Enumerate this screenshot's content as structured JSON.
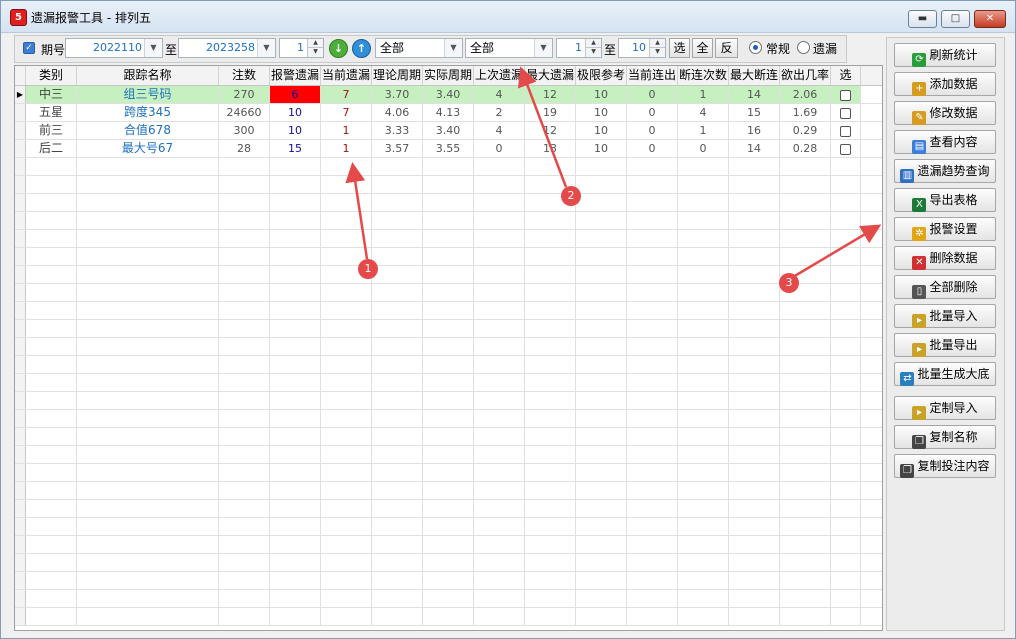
{
  "window": {
    "title": "遗漏报警工具 - 排列五",
    "app_icon": "5"
  },
  "toolbar": {
    "period_label": "期号",
    "period_from": "2022110",
    "to_label_1": "至",
    "period_to": "2023258",
    "spin_value": "1",
    "combo1": "全部",
    "combo2": "全部",
    "range_from": "1",
    "to_label_2": "至",
    "range_to": "10",
    "btn_select": "选",
    "btn_all": "全",
    "btn_invert": "反",
    "radio_normal": "常规",
    "radio_omission": "遗漏"
  },
  "table": {
    "columns": [
      "类别",
      "跟踪名称",
      "注数",
      "报警遗漏",
      "当前遗漏",
      "理论周期",
      "实际周期",
      "上次遗漏",
      "最大遗漏",
      "极限参考",
      "当前连出",
      "断连次数",
      "最大断连",
      "欲出几率",
      "选"
    ],
    "rows": [
      {
        "cat": "中三",
        "name": "组三号码",
        "count": "270",
        "alarm": "6",
        "cur": "7",
        "theory": "3.70",
        "actual": "3.40",
        "last": "4",
        "max": "12",
        "limit": "10",
        "cons": "0",
        "breaks": "1",
        "maxbreak": "14",
        "prob": "2.06"
      },
      {
        "cat": "五星",
        "name": "跨度345",
        "count": "24660",
        "alarm": "10",
        "cur": "7",
        "theory": "4.06",
        "actual": "4.13",
        "last": "2",
        "max": "19",
        "limit": "10",
        "cons": "0",
        "breaks": "4",
        "maxbreak": "15",
        "prob": "1.69"
      },
      {
        "cat": "前三",
        "name": "合值678",
        "count": "300",
        "alarm": "10",
        "cur": "1",
        "theory": "3.33",
        "actual": "3.40",
        "last": "4",
        "max": "12",
        "limit": "10",
        "cons": "0",
        "breaks": "1",
        "maxbreak": "16",
        "prob": "0.29"
      },
      {
        "cat": "后二",
        "name": "最大号67",
        "count": "28",
        "alarm": "15",
        "cur": "1",
        "theory": "3.57",
        "actual": "3.55",
        "last": "0",
        "max": "13",
        "limit": "10",
        "cons": "0",
        "breaks": "0",
        "maxbreak": "14",
        "prob": "0.28"
      }
    ]
  },
  "side_buttons": [
    {
      "label": "刷新统计",
      "icon": "refresh-icon"
    },
    {
      "label": "添加数据",
      "icon": "add-data-icon"
    },
    {
      "label": "修改数据",
      "icon": "edit-icon"
    },
    {
      "label": "查看内容",
      "icon": "view-icon"
    },
    {
      "label": "遗漏趋势查询",
      "icon": "trend-chart-icon"
    },
    {
      "label": "导出表格",
      "icon": "excel-icon"
    },
    {
      "label": "报警设置",
      "icon": "gear-icon"
    },
    {
      "label": "删除数据",
      "icon": "delete-icon"
    },
    {
      "label": "全部删除",
      "icon": "trash-icon"
    },
    {
      "label": "批量导入",
      "icon": "folder-import-icon"
    },
    {
      "label": "批量导出",
      "icon": "folder-export-icon"
    },
    {
      "label": "批量生成大底",
      "icon": "shuffle-icon"
    },
    {
      "label": "定制导入",
      "icon": "custom-import-icon"
    },
    {
      "label": "复制名称",
      "icon": "copy-icon"
    },
    {
      "label": "复制投注内容",
      "icon": "copy-icon"
    }
  ],
  "annotations": [
    "1",
    "2",
    "3"
  ],
  "colors": {
    "selected_row": "#c6f0c0",
    "alarm_cell": "#ff0000",
    "name_text": "#1d6fc0",
    "badge": "#e44a4a"
  }
}
